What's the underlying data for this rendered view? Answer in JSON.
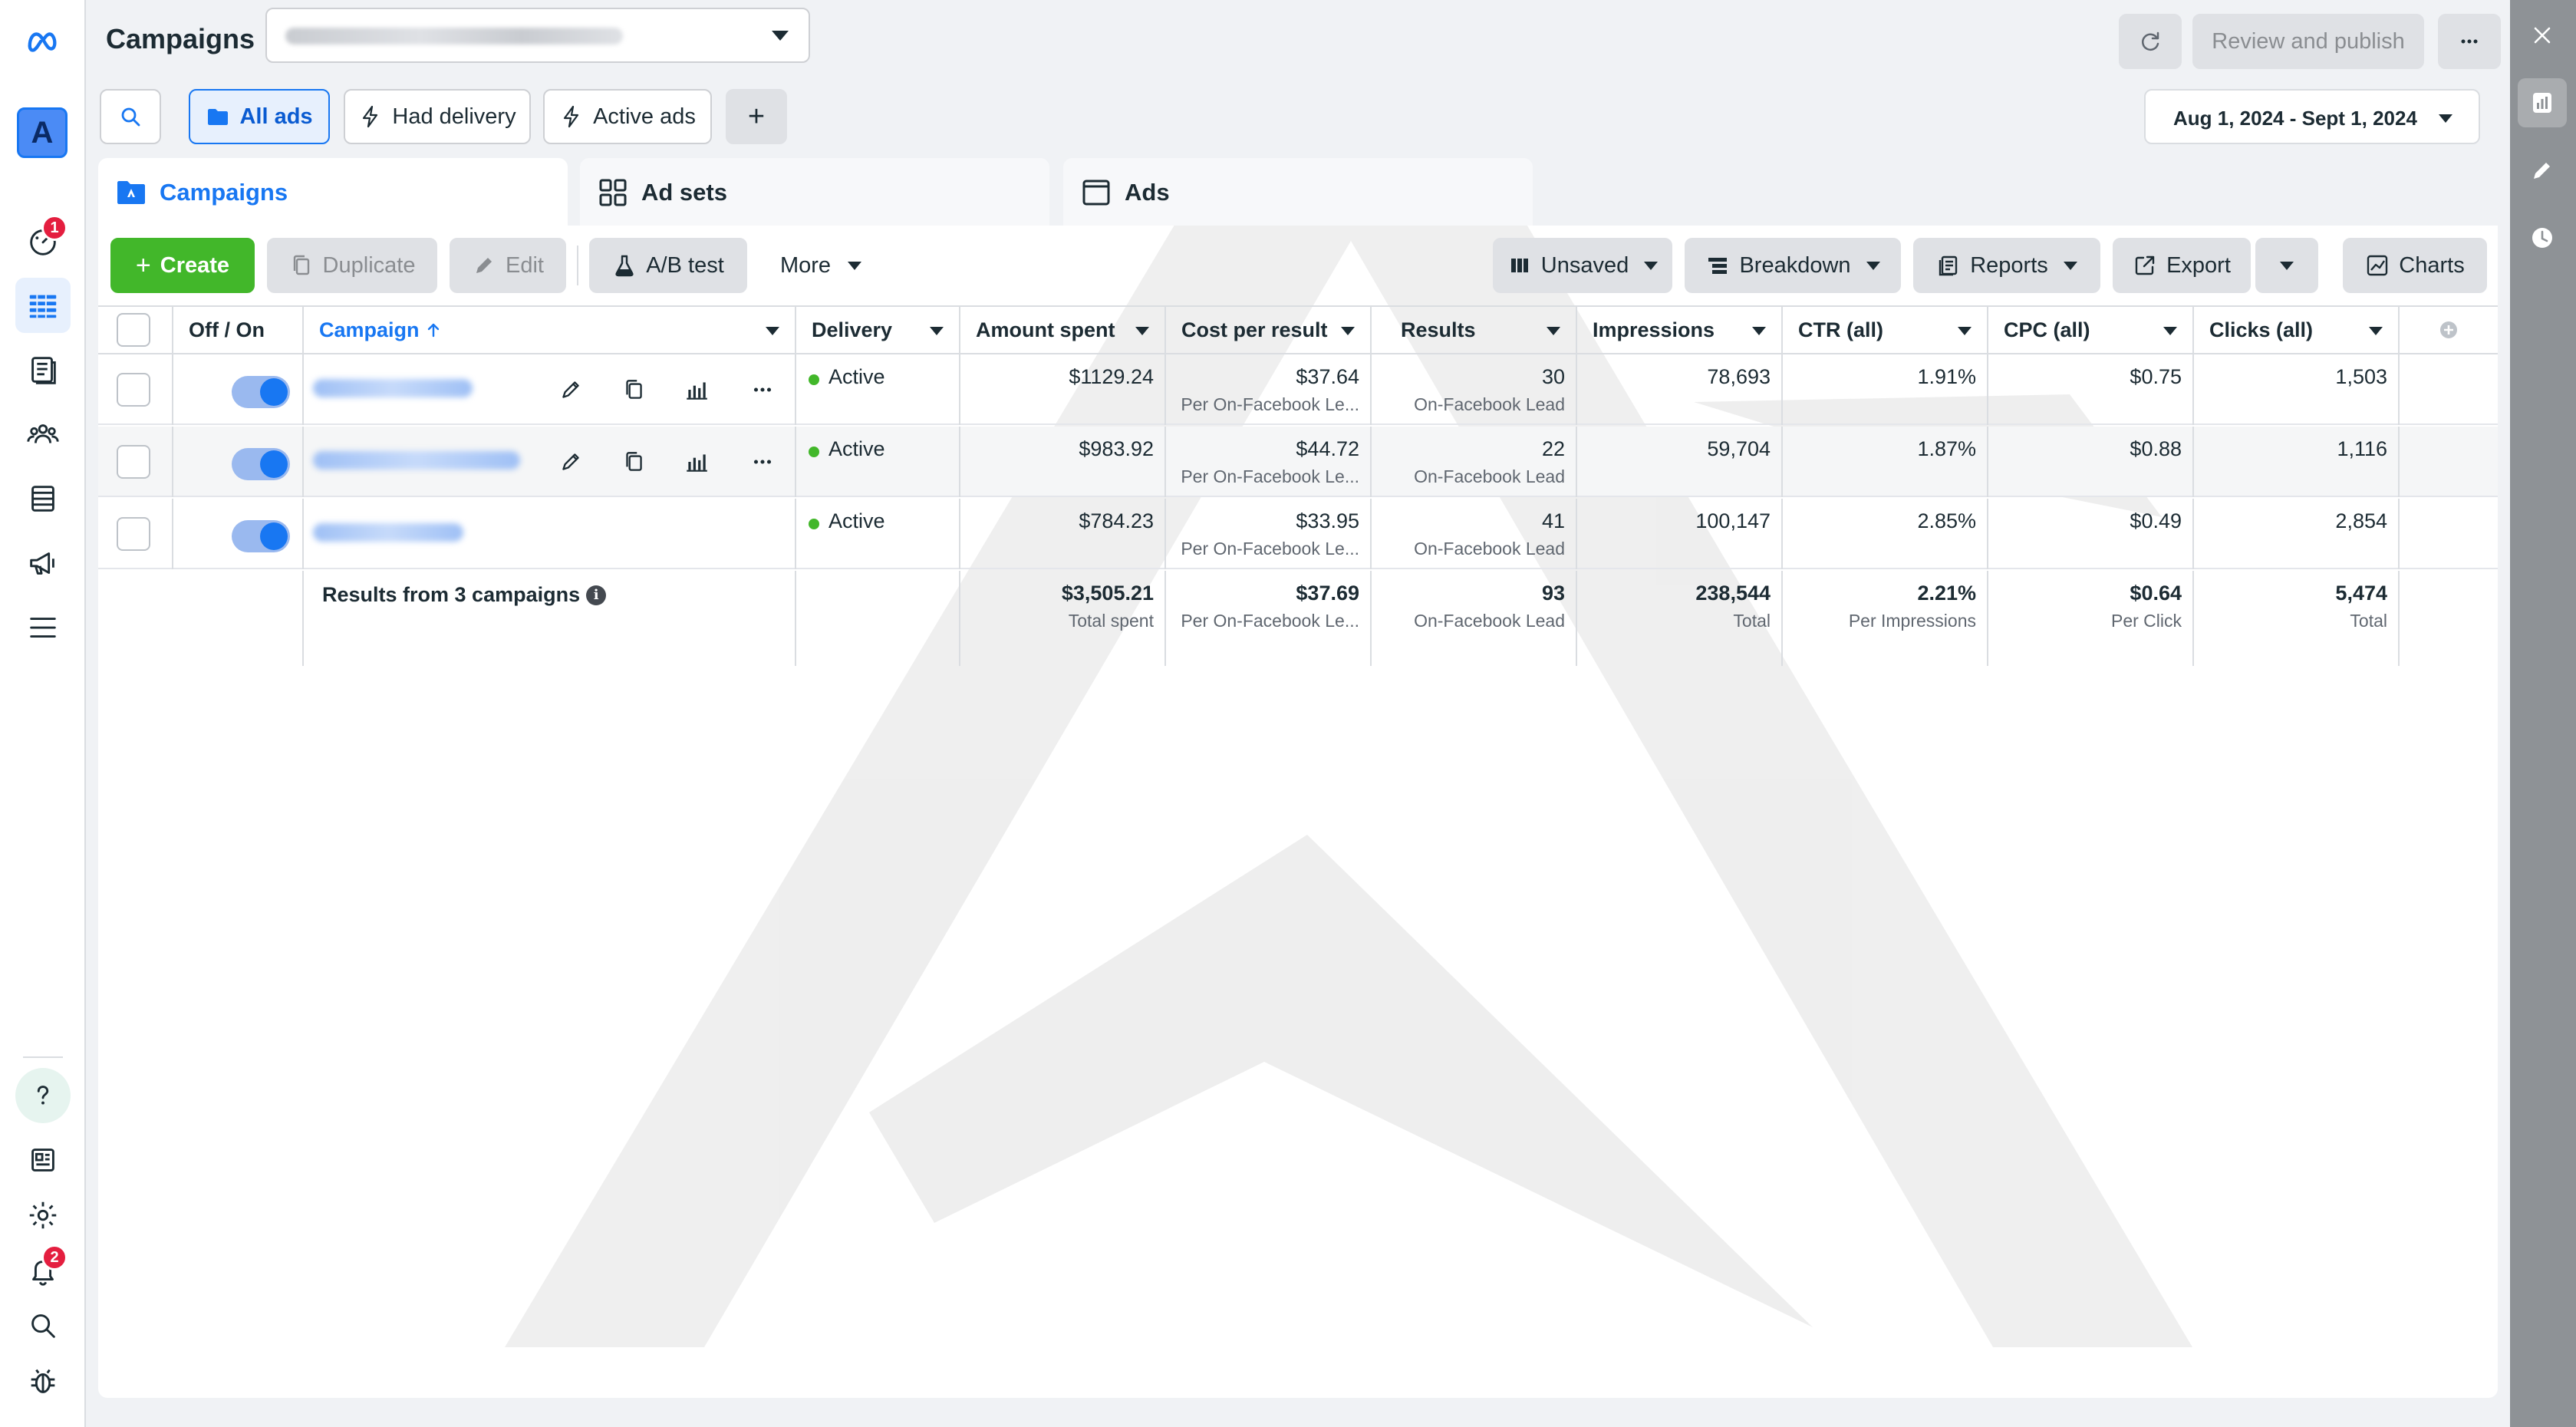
{
  "header": {
    "title": "Campaigns",
    "review_publish": "Review and publish"
  },
  "filters": {
    "all_ads": "All ads",
    "had_delivery": "Had delivery",
    "active_ads": "Active ads",
    "add": "+",
    "date_range": "Aug 1, 2024 - Sept 1, 2024"
  },
  "tabs": [
    {
      "label": "Campaigns"
    },
    {
      "label": "Ad sets"
    },
    {
      "label": "Ads"
    }
  ],
  "toolbar": {
    "create": "Create",
    "duplicate": "Duplicate",
    "edit": "Edit",
    "ab_test": "A/B test",
    "more": "More",
    "unsaved": "Unsaved",
    "breakdown": "Breakdown",
    "reports": "Reports",
    "export": "Export",
    "charts": "Charts"
  },
  "nav": {
    "account_initial": "A",
    "notifications_badge": "1",
    "alerts_badge": "2"
  },
  "table": {
    "columns": [
      "Off / On",
      "Campaign",
      "Delivery",
      "Amount spent",
      "Cost per result",
      "Results",
      "Impressions",
      "CTR (all)",
      "CPC (all)",
      "Clicks (all)"
    ],
    "rows": [
      {
        "delivery": "Active",
        "amount_spent": "$1129.24",
        "cost_per_result": "$37.64",
        "cost_per_result_sub": "Per On-Facebook Le...",
        "results": "30",
        "results_sub": "On-Facebook Lead",
        "impressions": "78,693",
        "ctr": "1.91%",
        "cpc": "$0.75",
        "clicks": "1,503"
      },
      {
        "delivery": "Active",
        "amount_spent": "$983.92",
        "cost_per_result": "$44.72",
        "cost_per_result_sub": "Per On-Facebook Le...",
        "results": "22",
        "results_sub": "On-Facebook Lead",
        "impressions": "59,704",
        "ctr": "1.87%",
        "cpc": "$0.88",
        "clicks": "1,116"
      },
      {
        "delivery": "Active",
        "amount_spent": "$784.23",
        "cost_per_result": "$33.95",
        "cost_per_result_sub": "Per On-Facebook Le...",
        "results": "41",
        "results_sub": "On-Facebook Lead",
        "impressions": "100,147",
        "ctr": "2.85%",
        "cpc": "$0.49",
        "clicks": "2,854"
      }
    ],
    "totals": {
      "label": "Results from 3 campaigns",
      "amount_spent": "$3,505.21",
      "amount_spent_sub": "Total spent",
      "cost_per_result": "$37.69",
      "cost_per_result_sub": "Per On-Facebook Le...",
      "results": "93",
      "results_sub": "On-Facebook Lead",
      "impressions": "238,544",
      "impressions_sub": "Total",
      "ctr": "2.21%",
      "ctr_sub": "Per Impressions",
      "cpc": "$0.64",
      "cpc_sub": "Per Click",
      "clicks": "5,474",
      "clicks_sub": "Total"
    }
  },
  "colors": {
    "accent": "#1877f2",
    "create_green": "#42b72a",
    "badge_red": "#e41e3f",
    "right_rail": "#8e9296"
  },
  "icons": [
    "meta-logo-icon",
    "search-icon",
    "folder-icon",
    "lightning-icon",
    "grid-icon",
    "ad-icon",
    "copy-icon",
    "pencil-icon",
    "flask-icon",
    "columns-icon",
    "breakdown-icon",
    "reports-icon",
    "export-icon",
    "chart-icon",
    "refresh-icon",
    "more-icon",
    "close-icon",
    "clock-icon",
    "gear-icon",
    "bell-icon",
    "bug-icon",
    "question-icon",
    "people-icon",
    "megaphone-icon",
    "menu-icon"
  ]
}
